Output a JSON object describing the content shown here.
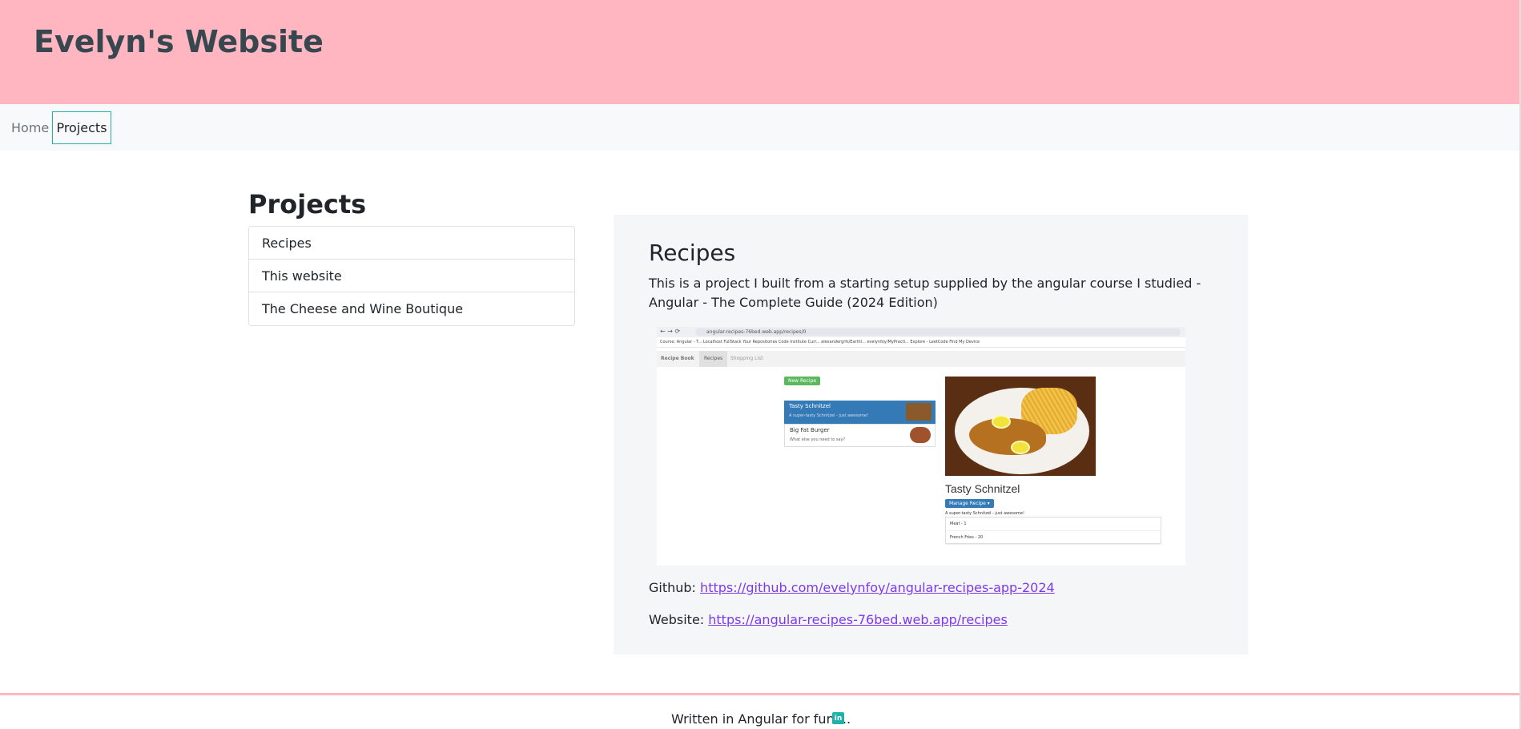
{
  "header": {
    "title": "Evelyn's Website"
  },
  "nav": {
    "items": [
      {
        "label": "Home"
      },
      {
        "label": "Projects"
      }
    ]
  },
  "sidebar": {
    "heading": "Projects",
    "items": [
      {
        "label": "Recipes"
      },
      {
        "label": "This website"
      },
      {
        "label": "The Cheese and Wine Boutique"
      }
    ]
  },
  "detail": {
    "title": "Recipes",
    "description": "This is a project I built from a starting setup supplied by the angular course I studied - Angular - The Complete Guide (2024 Edition)",
    "github_label": "Github:",
    "github_url": "https://github.com/evelynfoy/angular-recipes-app-2024",
    "website_label": "Website:",
    "website_url": "https://angular-recipes-76bed.web.app/recipes"
  },
  "screenshot": {
    "url": "angular-recipes-76bed.web.app/recipes/0",
    "bookmarks": "Course: Angular - T...   Localhost   FullStack   Your Repositories   Code Institute Curr...   alexandergrfs/Earthl...   evelynfoy/MyPracti...   Explore - LeetCode   Find My Device",
    "brand": "Recipe Book",
    "tab_recipes": "Recipes",
    "tab_shopping": "Shopping List",
    "new_recipe": "New Recipe",
    "recipes": [
      {
        "name": "Tasty Schnitzel",
        "desc": "A super-tasty Schnitzel - just awesome!"
      },
      {
        "name": "Big Fat Burger",
        "desc": "What else you need to say?"
      }
    ],
    "selected_title": "Tasty Schnitzel",
    "manage": "Manage Recipe ▾",
    "selected_desc": "A super-tasty Schnitzel - just awesome!",
    "ingredients": [
      "Meat - 1",
      "French Fries - 20"
    ]
  },
  "footer": {
    "text": "Written in Angular for fun ...",
    "linkedin_icon": "linkedin-icon"
  },
  "colors": {
    "header_bg": "#ffb6c1",
    "accent": "#20b2aa",
    "link": "#7c3aed",
    "panel_bg": "#f5f6f8"
  }
}
